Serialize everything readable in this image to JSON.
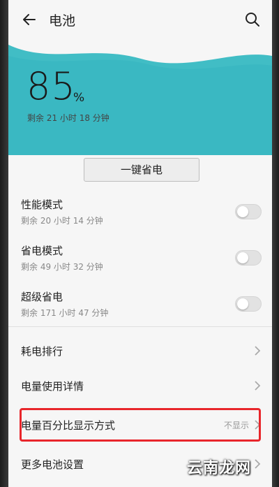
{
  "header": {
    "title": "电池"
  },
  "battery": {
    "percent": "85",
    "percent_sign": "%",
    "remaining": "剩余 21 小时 18 分钟"
  },
  "one_key_button": "一键省电",
  "modes": [
    {
      "title": "性能模式",
      "subtitle": "剩余 20 小时 14 分钟",
      "enabled": false
    },
    {
      "title": "省电模式",
      "subtitle": "剩余 49 小时 32 分钟",
      "enabled": false
    },
    {
      "title": "超级省电",
      "subtitle": "剩余 171 小时 47 分钟",
      "enabled": false
    }
  ],
  "menu": [
    {
      "label": "耗电排行",
      "value": ""
    },
    {
      "label": "电量使用详情",
      "value": ""
    },
    {
      "label": "电量百分比显示方式",
      "value": "不显示"
    },
    {
      "label": "更多电池设置",
      "value": ""
    }
  ],
  "watermark": "云南龙网",
  "colors": {
    "wave": "#3cbcc4",
    "highlight": "#e8262b"
  }
}
